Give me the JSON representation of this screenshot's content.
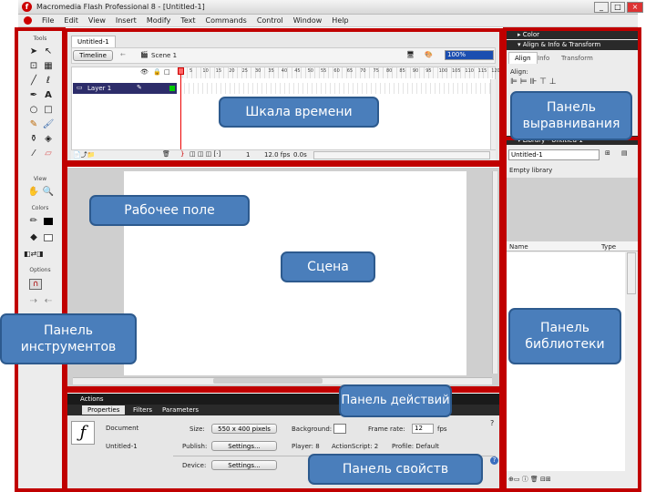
{
  "window": {
    "title": "Macromedia Flash Professional 8 - [Untitled-1]",
    "logo_letter": "f",
    "min": "_",
    "max": "□",
    "close": "×"
  },
  "menu": [
    "File",
    "Edit",
    "View",
    "Insert",
    "Modify",
    "Text",
    "Commands",
    "Control",
    "Window",
    "Help"
  ],
  "tools": {
    "header": "Tools",
    "view_header": "View",
    "colors_header": "Colors",
    "options_header": "Options"
  },
  "timeline": {
    "doc_tab": "Untitled-1",
    "timeline_btn": "Timeline",
    "scene": "Scene 1",
    "zoom": "100%",
    "layer_name": "Layer 1",
    "frame_labels": [
      "5",
      "10",
      "15",
      "20",
      "25",
      "30",
      "35",
      "40",
      "45",
      "50",
      "55",
      "60",
      "65",
      "70",
      "75",
      "80",
      "85",
      "90",
      "95",
      "100",
      "105",
      "110",
      "115",
      "120"
    ],
    "current_frame": "1",
    "fps": "12.0 fps",
    "time": "0.0s"
  },
  "right": {
    "color_panel": "Color",
    "align_panel": "Align & Info & Transform",
    "tabs": [
      "Align",
      "Info",
      "Transform"
    ],
    "align_label": "Align:",
    "library_panel": "Library - Untitled-1",
    "library_select": "Untitled-1",
    "empty_library": "Empty library",
    "col_name": "Name",
    "col_type": "Type"
  },
  "actions": {
    "label": "Actions"
  },
  "props": {
    "tabs": [
      "Properties",
      "Filters",
      "Parameters"
    ],
    "doc_label": "Document",
    "doc_name": "Untitled-1",
    "size_label": "Size:",
    "size_value": "550 x 400 pixels",
    "bg_label": "Background:",
    "framerate_label": "Frame rate:",
    "framerate_value": "12",
    "fps_unit": "fps",
    "publish_label": "Publish:",
    "settings_btn": "Settings...",
    "player_label": "Player: 8",
    "actionscript_label": "ActionScript: 2",
    "profile_label": "Profile: Default",
    "device_label": "Device:",
    "device_btn": "Settings..."
  },
  "callouts": {
    "timeline": "Шкала времени",
    "align": "Панель выравнивания",
    "workspace": "Рабочее поле",
    "stage": "Сцена",
    "tools": "Панель инструментов",
    "library": "Панель библиотеки",
    "actions": "Панель действий",
    "properties": "Панель свойств"
  },
  "colors": {
    "frame": "#c00000",
    "callout_bg": "#4a7ebb",
    "callout_border": "#2d5a8e"
  }
}
